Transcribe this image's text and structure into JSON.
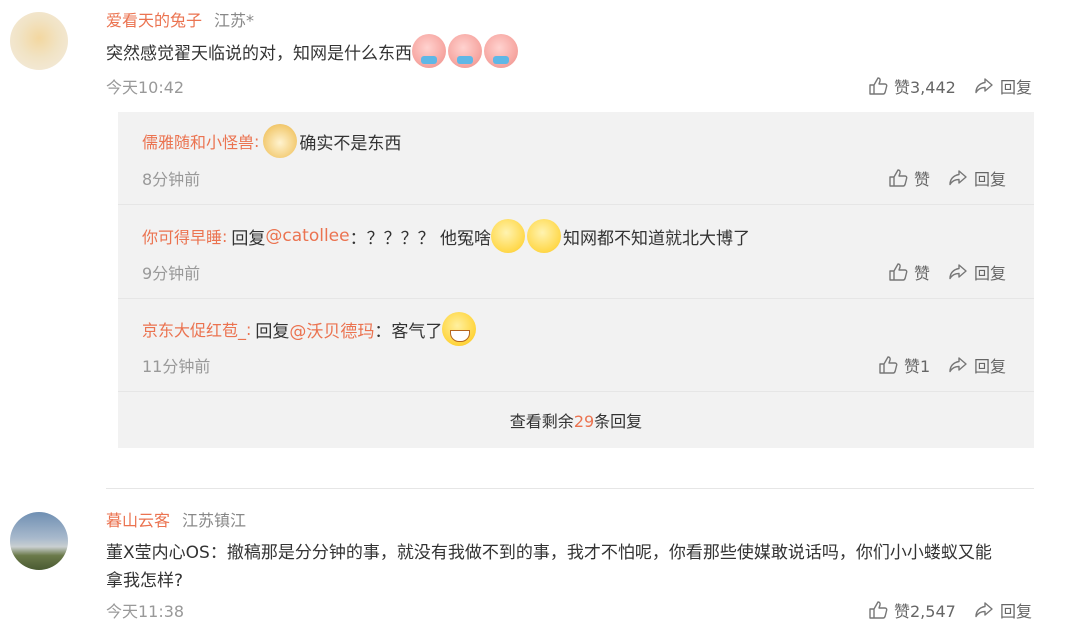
{
  "comments": [
    {
      "username": "爱看天的兔子",
      "location": "江苏*",
      "text": "突然感觉翟天临说的对，知网是什么东西",
      "time": "今天10:42",
      "like_label": "赞3,442",
      "reply_label": "回复",
      "emojis": [
        "cry-emoji",
        "cry-emoji",
        "cry-emoji"
      ]
    },
    {
      "username": "暮山云客",
      "location": "江苏镇江",
      "text_line1": "董X莹内心OS：撤稿那是分分钟的事，就没有我做不到的事，我才不怕呢，你看那些使媒敢说话吗，你们小小蝼蚁又能",
      "text_line2": "拿我怎样?",
      "time": "今天11:38",
      "like_label": "赞2,547",
      "reply_label": "回复"
    }
  ],
  "replies": [
    {
      "username": "儒雅随和小怪兽",
      "sep": ":",
      "text": "确实不是东西",
      "time": "8分钟前",
      "like_label": "赞",
      "reply_label": "回复"
    },
    {
      "username": "你可得早睡",
      "sep": ":",
      "reply_prefix": "回复",
      "mention": "@catollee",
      "text_a": "：？？？？ 他冤啥",
      "text_b": "知网都不知道就北大博了",
      "time": "9分钟前",
      "like_label": "赞",
      "reply_label": "回复"
    },
    {
      "username": "京东大促红苞_",
      "sep": ":",
      "reply_prefix": "回复",
      "mention": "@沃贝德玛",
      "text_a": "：客气了",
      "time": "11分钟前",
      "like_label": "赞1",
      "reply_label": "回复"
    }
  ],
  "more_replies": {
    "prefix": "查看剩余",
    "count": "29",
    "suffix": "条回复"
  }
}
